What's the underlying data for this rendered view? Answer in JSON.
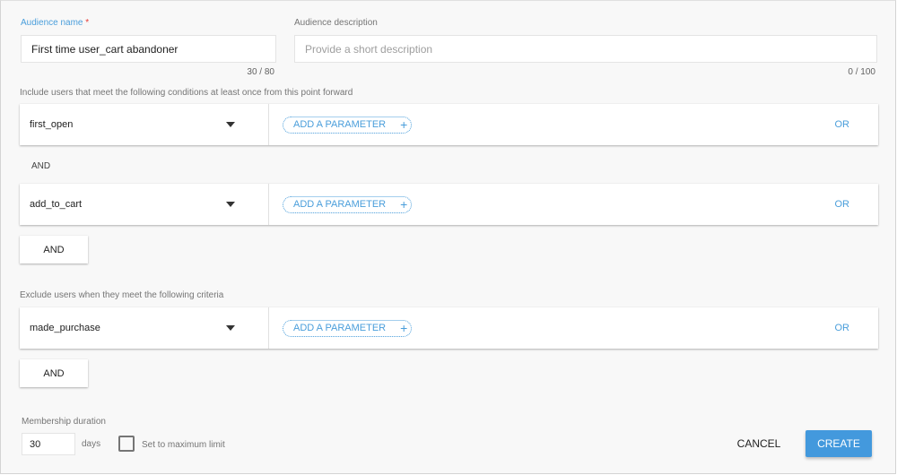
{
  "audience": {
    "name_label": "Audience name",
    "required_mark": "*",
    "name_value": "First time user_cart abandoner",
    "name_counter": "30 / 80",
    "description_label": "Audience description",
    "description_placeholder": "Provide a short description",
    "description_value": "",
    "description_counter": "0 / 100"
  },
  "include": {
    "heading": "Include users that meet the following conditions at least once from this point forward",
    "conditions": [
      {
        "event": "first_open",
        "add_param_label": "ADD A PARAMETER",
        "add_param_icon": "plus-icon",
        "or_label": "OR"
      },
      {
        "event": "add_to_cart",
        "add_param_label": "ADD A PARAMETER",
        "add_param_icon": "plus-icon",
        "or_label": "OR"
      }
    ],
    "and_separator": "AND",
    "and_button": "AND"
  },
  "exclude": {
    "heading": "Exclude users when they meet the following criteria",
    "conditions": [
      {
        "event": "made_purchase",
        "add_param_label": "ADD A PARAMETER",
        "add_param_icon": "plus-icon",
        "or_label": "OR"
      }
    ],
    "and_button": "AND"
  },
  "membership": {
    "label": "Membership duration",
    "value": "30",
    "unit": "days",
    "max_limit_label": "Set to maximum limit",
    "max_limit_checked": false
  },
  "actions": {
    "cancel": "CANCEL",
    "create": "CREATE"
  },
  "icons": {
    "plus": "+",
    "dropdown": "caret-down"
  },
  "colors": {
    "accent": "#4a9edb",
    "primary_button": "#4399dd",
    "required": "#e53935"
  }
}
